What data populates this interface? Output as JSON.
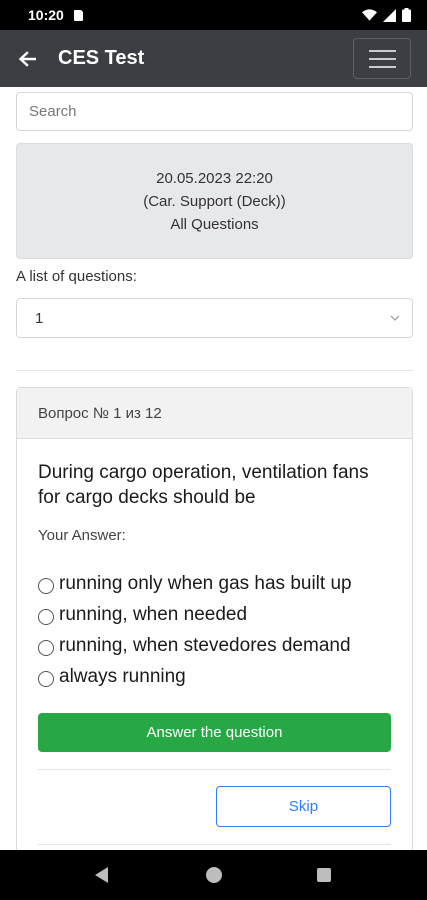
{
  "status_bar": {
    "time": "10:20"
  },
  "app_bar": {
    "title": "CES Test"
  },
  "search": {
    "placeholder": "Search",
    "value": ""
  },
  "info": {
    "datetime": "20.05.2023 22:20",
    "category": "(Car. Support (Deck))",
    "mode": "All Questions"
  },
  "question_list": {
    "label": "A list of questions:",
    "selected": "1"
  },
  "card": {
    "header": "Вопрос № 1 из 12",
    "question": "During cargo operation, ventilation fans for cargo decks should be",
    "answer_label": "Your Answer:",
    "options": [
      {
        "label": "running only when gas has built up"
      },
      {
        "label": "running, when needed"
      },
      {
        "label": "running, when stevedores demand"
      },
      {
        "label": "always running"
      }
    ],
    "answer_button": "Answer the question",
    "skip_button": "Skip"
  }
}
